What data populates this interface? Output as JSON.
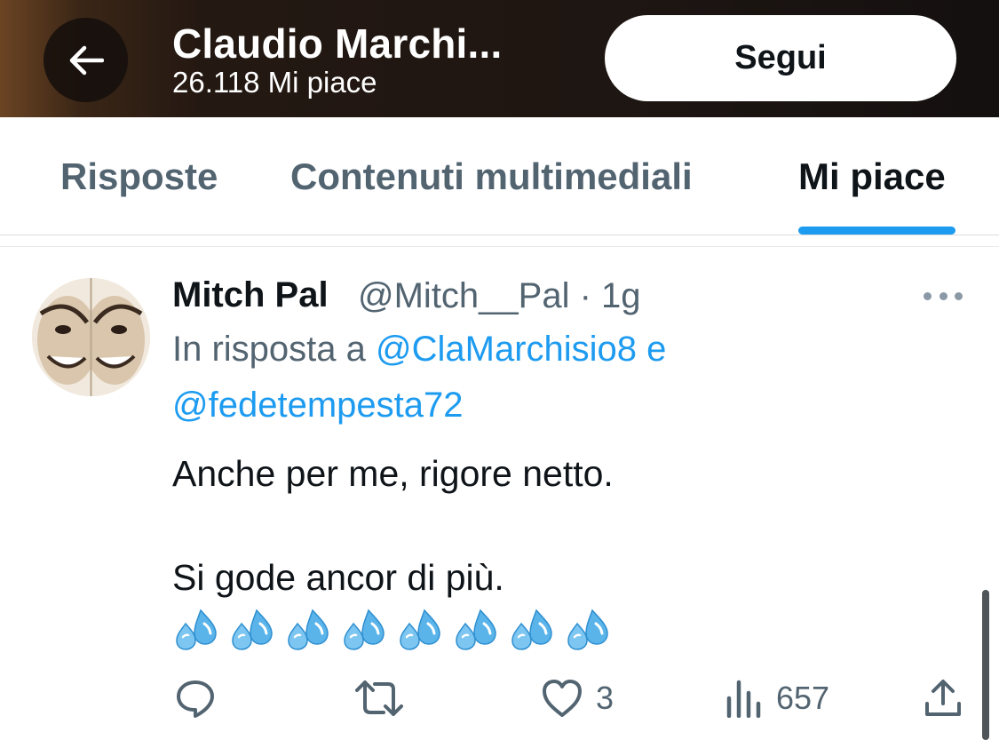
{
  "header": {
    "title": "Claudio Marchi...",
    "subtitle": "26.118 Mi piace",
    "follow_label": "Segui"
  },
  "tabs": [
    {
      "label": "Risposte",
      "active": false
    },
    {
      "label": "Contenuti multimediali",
      "active": false
    },
    {
      "label": "Mi piace",
      "active": true
    }
  ],
  "tweet": {
    "author_name": "Mitch Pal",
    "author_handle": "@Mitch__Pal · 1g",
    "reply_prefix": "In risposta a",
    "reply_user1": "@ClaMarchisio8",
    "reply_conj": "e",
    "reply_user2": "@fedetempesta72",
    "text_line1": "Anche per me, rigore netto.",
    "text_line2": "Si gode ancor di più.",
    "emoji": "sweat-droplets",
    "emoji_count": 8,
    "actions": {
      "reply_count": "",
      "retweet_count": "",
      "like_count": "3",
      "views_count": "657"
    }
  },
  "colors": {
    "accent": "#1d9bf0",
    "secondary_text": "#536471",
    "primary_text": "#0f1419"
  },
  "icons": [
    "back-arrow-icon",
    "more-icon",
    "reply-icon",
    "retweet-icon",
    "like-icon",
    "views-icon",
    "share-icon"
  ]
}
